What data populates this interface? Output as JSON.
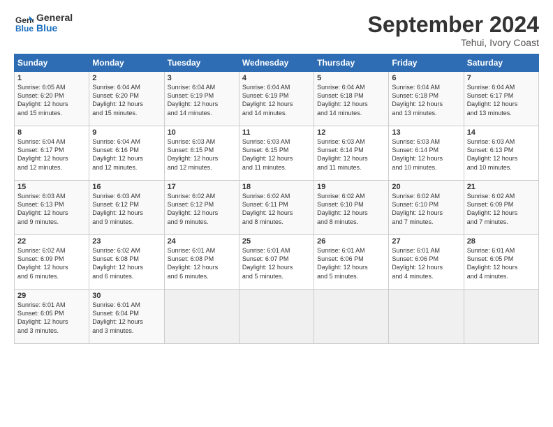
{
  "header": {
    "logo_line1": "General",
    "logo_line2": "Blue",
    "month_title": "September 2024",
    "location": "Tehui, Ivory Coast"
  },
  "columns": [
    "Sunday",
    "Monday",
    "Tuesday",
    "Wednesday",
    "Thursday",
    "Friday",
    "Saturday"
  ],
  "rows": [
    [
      {
        "day": "1",
        "info": "Sunrise: 6:05 AM\nSunset: 6:20 PM\nDaylight: 12 hours\nand 15 minutes."
      },
      {
        "day": "2",
        "info": "Sunrise: 6:04 AM\nSunset: 6:20 PM\nDaylight: 12 hours\nand 15 minutes."
      },
      {
        "day": "3",
        "info": "Sunrise: 6:04 AM\nSunset: 6:19 PM\nDaylight: 12 hours\nand 14 minutes."
      },
      {
        "day": "4",
        "info": "Sunrise: 6:04 AM\nSunset: 6:19 PM\nDaylight: 12 hours\nand 14 minutes."
      },
      {
        "day": "5",
        "info": "Sunrise: 6:04 AM\nSunset: 6:18 PM\nDaylight: 12 hours\nand 14 minutes."
      },
      {
        "day": "6",
        "info": "Sunrise: 6:04 AM\nSunset: 6:18 PM\nDaylight: 12 hours\nand 13 minutes."
      },
      {
        "day": "7",
        "info": "Sunrise: 6:04 AM\nSunset: 6:17 PM\nDaylight: 12 hours\nand 13 minutes."
      }
    ],
    [
      {
        "day": "8",
        "info": "Sunrise: 6:04 AM\nSunset: 6:17 PM\nDaylight: 12 hours\nand 12 minutes."
      },
      {
        "day": "9",
        "info": "Sunrise: 6:04 AM\nSunset: 6:16 PM\nDaylight: 12 hours\nand 12 minutes."
      },
      {
        "day": "10",
        "info": "Sunrise: 6:03 AM\nSunset: 6:15 PM\nDaylight: 12 hours\nand 12 minutes."
      },
      {
        "day": "11",
        "info": "Sunrise: 6:03 AM\nSunset: 6:15 PM\nDaylight: 12 hours\nand 11 minutes."
      },
      {
        "day": "12",
        "info": "Sunrise: 6:03 AM\nSunset: 6:14 PM\nDaylight: 12 hours\nand 11 minutes."
      },
      {
        "day": "13",
        "info": "Sunrise: 6:03 AM\nSunset: 6:14 PM\nDaylight: 12 hours\nand 10 minutes."
      },
      {
        "day": "14",
        "info": "Sunrise: 6:03 AM\nSunset: 6:13 PM\nDaylight: 12 hours\nand 10 minutes."
      }
    ],
    [
      {
        "day": "15",
        "info": "Sunrise: 6:03 AM\nSunset: 6:13 PM\nDaylight: 12 hours\nand 9 minutes."
      },
      {
        "day": "16",
        "info": "Sunrise: 6:03 AM\nSunset: 6:12 PM\nDaylight: 12 hours\nand 9 minutes."
      },
      {
        "day": "17",
        "info": "Sunrise: 6:02 AM\nSunset: 6:12 PM\nDaylight: 12 hours\nand 9 minutes."
      },
      {
        "day": "18",
        "info": "Sunrise: 6:02 AM\nSunset: 6:11 PM\nDaylight: 12 hours\nand 8 minutes."
      },
      {
        "day": "19",
        "info": "Sunrise: 6:02 AM\nSunset: 6:10 PM\nDaylight: 12 hours\nand 8 minutes."
      },
      {
        "day": "20",
        "info": "Sunrise: 6:02 AM\nSunset: 6:10 PM\nDaylight: 12 hours\nand 7 minutes."
      },
      {
        "day": "21",
        "info": "Sunrise: 6:02 AM\nSunset: 6:09 PM\nDaylight: 12 hours\nand 7 minutes."
      }
    ],
    [
      {
        "day": "22",
        "info": "Sunrise: 6:02 AM\nSunset: 6:09 PM\nDaylight: 12 hours\nand 6 minutes."
      },
      {
        "day": "23",
        "info": "Sunrise: 6:02 AM\nSunset: 6:08 PM\nDaylight: 12 hours\nand 6 minutes."
      },
      {
        "day": "24",
        "info": "Sunrise: 6:01 AM\nSunset: 6:08 PM\nDaylight: 12 hours\nand 6 minutes."
      },
      {
        "day": "25",
        "info": "Sunrise: 6:01 AM\nSunset: 6:07 PM\nDaylight: 12 hours\nand 5 minutes."
      },
      {
        "day": "26",
        "info": "Sunrise: 6:01 AM\nSunset: 6:06 PM\nDaylight: 12 hours\nand 5 minutes."
      },
      {
        "day": "27",
        "info": "Sunrise: 6:01 AM\nSunset: 6:06 PM\nDaylight: 12 hours\nand 4 minutes."
      },
      {
        "day": "28",
        "info": "Sunrise: 6:01 AM\nSunset: 6:05 PM\nDaylight: 12 hours\nand 4 minutes."
      }
    ],
    [
      {
        "day": "29",
        "info": "Sunrise: 6:01 AM\nSunset: 6:05 PM\nDaylight: 12 hours\nand 3 minutes."
      },
      {
        "day": "30",
        "info": "Sunrise: 6:01 AM\nSunset: 6:04 PM\nDaylight: 12 hours\nand 3 minutes."
      },
      {
        "day": "",
        "info": ""
      },
      {
        "day": "",
        "info": ""
      },
      {
        "day": "",
        "info": ""
      },
      {
        "day": "",
        "info": ""
      },
      {
        "day": "",
        "info": ""
      }
    ]
  ]
}
